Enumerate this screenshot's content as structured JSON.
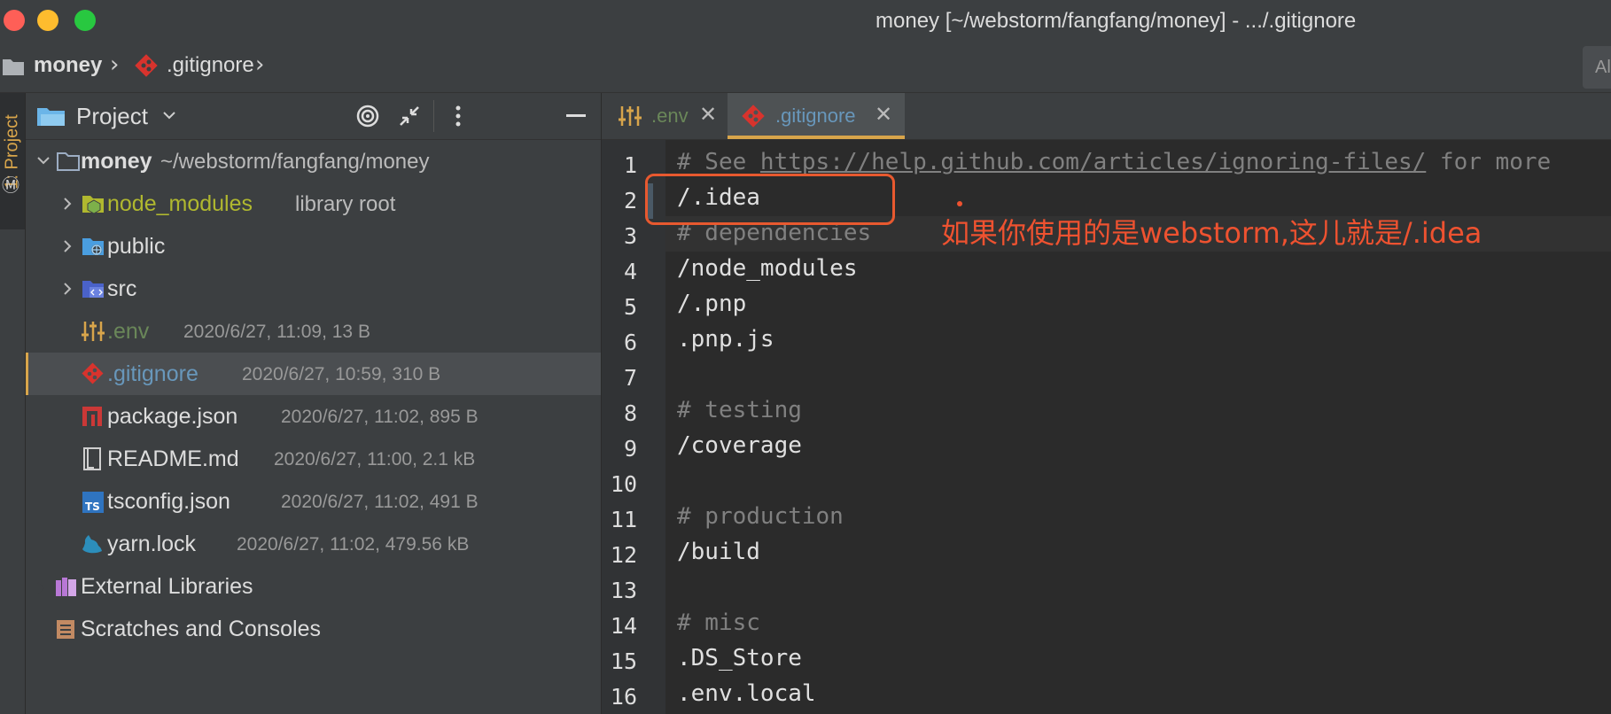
{
  "window": {
    "title": "money [~/webstorm/fangfang/money] - .../.gitignore"
  },
  "breadcrumb": {
    "project": "money",
    "file": ".gitignore",
    "right_partial": "Al"
  },
  "toolwindow_strip": {
    "project_tab": "1: Project"
  },
  "project_panel": {
    "title": "Project",
    "tree": [
      {
        "name": "money",
        "meta": "~/webstorm/fangfang/money",
        "icon": "folder-icon",
        "expanded": true
      },
      {
        "name": "node_modules",
        "meta": "library root",
        "icon": "library-folder-icon"
      },
      {
        "name": "public",
        "meta": "",
        "icon": "web-folder-icon"
      },
      {
        "name": "src",
        "meta": "",
        "icon": "source-folder-icon"
      },
      {
        "name": ".env",
        "meta": "2020/6/27, 11:09, 13 B",
        "icon": "env-settings-icon"
      },
      {
        "name": ".gitignore",
        "meta": "2020/6/27, 10:59, 310 B",
        "icon": "git-icon",
        "selected": true
      },
      {
        "name": "package.json",
        "meta": "2020/6/27, 11:02, 895 B",
        "icon": "npm-icon"
      },
      {
        "name": "README.md",
        "meta": "2020/6/27, 11:00, 2.1 kB",
        "icon": "markdown-icon"
      },
      {
        "name": "tsconfig.json",
        "meta": "2020/6/27, 11:02, 491 B",
        "icon": "typescript-icon"
      },
      {
        "name": "yarn.lock",
        "meta": "2020/6/27, 11:02, 479.56 kB",
        "icon": "yarn-icon"
      },
      {
        "name": "External Libraries",
        "meta": "",
        "icon": "external-libraries-icon"
      },
      {
        "name": "Scratches and Consoles",
        "meta": "",
        "icon": "scratches-icon"
      }
    ]
  },
  "editor": {
    "tabs": [
      {
        "label": ".env",
        "active": false
      },
      {
        "label": ".gitignore",
        "active": true
      }
    ],
    "lines": [
      {
        "n": "1",
        "text": "# See ",
        "url": "https://help.github.com/articles/ignoring-files/",
        "after": " for more",
        "type": "comment"
      },
      {
        "n": "2",
        "text": "/.idea",
        "type": "plain"
      },
      {
        "n": "3",
        "text": "# dependencies",
        "type": "comment"
      },
      {
        "n": "4",
        "text": "/node_modules",
        "type": "plain"
      },
      {
        "n": "5",
        "text": "/.pnp",
        "type": "plain"
      },
      {
        "n": "6",
        "text": ".pnp.js",
        "type": "plain"
      },
      {
        "n": "7",
        "text": "",
        "type": "plain"
      },
      {
        "n": "8",
        "text": "# testing",
        "type": "comment"
      },
      {
        "n": "9",
        "text": "/coverage",
        "type": "plain"
      },
      {
        "n": "10",
        "text": "",
        "type": "plain"
      },
      {
        "n": "11",
        "text": "# production",
        "type": "comment"
      },
      {
        "n": "12",
        "text": "/build",
        "type": "plain"
      },
      {
        "n": "13",
        "text": "",
        "type": "plain"
      },
      {
        "n": "14",
        "text": "# misc",
        "type": "comment"
      },
      {
        "n": "15",
        "text": ".DS_Store",
        "type": "plain"
      },
      {
        "n": "16",
        "text": ".env.local",
        "type": "plain"
      }
    ],
    "annotation": "如果你使用的是webstorm,这儿就是/.idea"
  },
  "colors": {
    "accent": "#d8a54b",
    "annotation_red": "#ee5230",
    "comment": "#808080",
    "library_root": "#b0b82f",
    "env_name": "#6a8759",
    "git_name": "#6897bb"
  }
}
